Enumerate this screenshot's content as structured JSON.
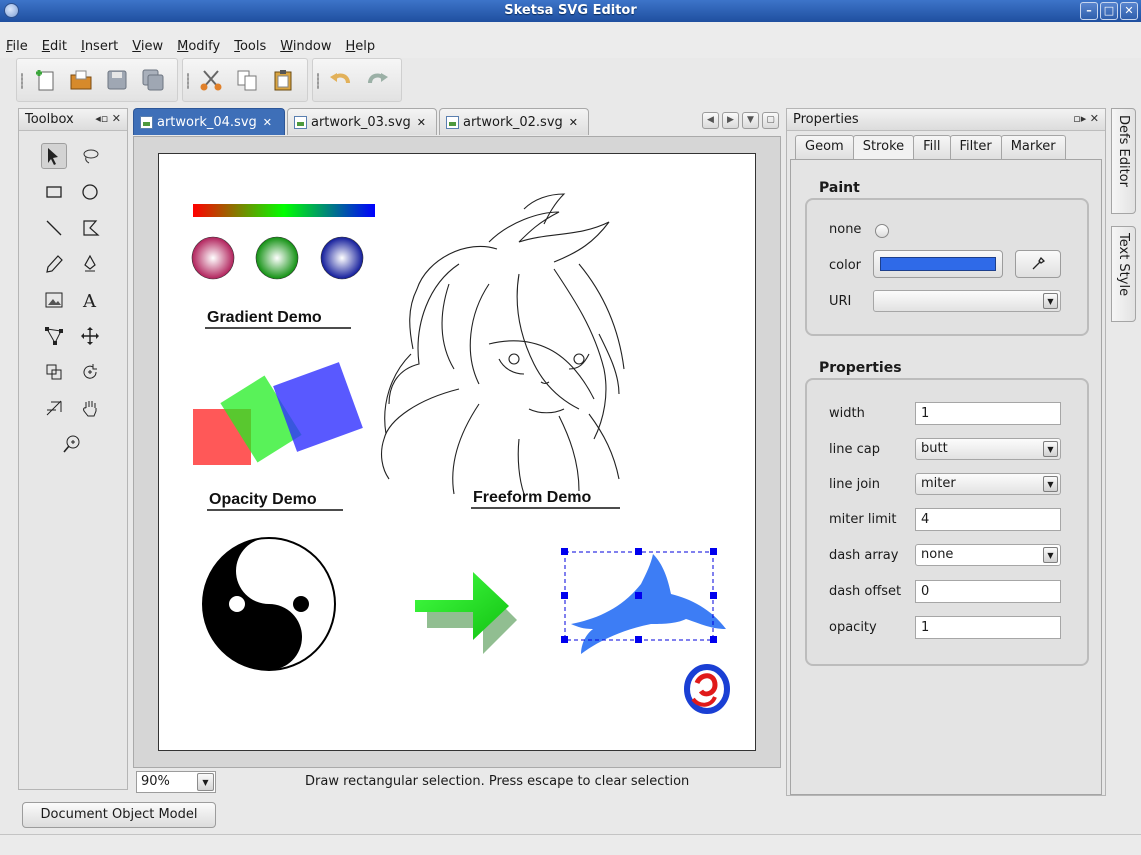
{
  "window": {
    "title": "Sketsa SVG Editor",
    "controls": [
      "minimize",
      "maximize",
      "close"
    ]
  },
  "menu": {
    "items": [
      {
        "label": "File",
        "mnemonic": "F"
      },
      {
        "label": "Edit",
        "mnemonic": "E"
      },
      {
        "label": "Insert",
        "mnemonic": "I"
      },
      {
        "label": "View",
        "mnemonic": "V"
      },
      {
        "label": "Modify",
        "mnemonic": "M"
      },
      {
        "label": "Tools",
        "mnemonic": "T"
      },
      {
        "label": "Window",
        "mnemonic": "W"
      },
      {
        "label": "Help",
        "mnemonic": "H"
      }
    ]
  },
  "toolbar": {
    "groups": [
      [
        "new-file-icon",
        "open-folder-icon",
        "save-icon",
        "save-all-icon"
      ],
      [
        "cut-icon",
        "copy-icon",
        "paste-icon"
      ],
      [
        "undo-icon",
        "redo-icon"
      ]
    ]
  },
  "toolbox": {
    "title": "Toolbox",
    "tools": [
      "select-arrow-icon",
      "lasso-icon",
      "rectangle-icon",
      "ellipse-icon",
      "line-icon",
      "polyline-icon",
      "pencil-icon",
      "pen-icon",
      "image-icon",
      "text-icon",
      "node-edit-icon",
      "move-icon",
      "transform-icon",
      "rotate-icon",
      "gradient-icon",
      "hand-icon",
      "zoom-icon"
    ]
  },
  "documents": {
    "tabs": [
      {
        "label": "artwork_04.svg",
        "active": true
      },
      {
        "label": "artwork_03.svg",
        "active": false
      },
      {
        "label": "artwork_02.svg",
        "active": false
      }
    ]
  },
  "canvas": {
    "labels": {
      "gradient": "Gradient Demo",
      "opacity": "Opacity Demo",
      "freeform": "Freeform Demo"
    },
    "colors": {
      "gradient_red": "#b0205a",
      "gradient_green": "#109010",
      "gradient_blue": "#101a9a",
      "opacity_red": "#ff4444",
      "opacity_green": "#33ee33",
      "opacity_blue": "#3333ff",
      "arrow": "#22dd22",
      "dolphin": "#3d7df5",
      "selection": "#0000dd"
    }
  },
  "statusbar": {
    "zoom": "90%",
    "message": "Draw rectangular selection. Press escape to clear selection"
  },
  "properties": {
    "title": "Properties",
    "tabs": [
      "Geom",
      "Stroke",
      "Fill",
      "Filter",
      "Marker"
    ],
    "active_tab": "Stroke",
    "paint": {
      "title": "Paint",
      "none_label": "none",
      "color_label": "color",
      "color_value": "#2f6ae8",
      "uri_label": "URI",
      "uri_value": ""
    },
    "props": {
      "title": "Properties",
      "width_label": "width",
      "width_value": "1",
      "linecap_label": "line cap",
      "linecap_value": "butt",
      "linejoin_label": "line join",
      "linejoin_value": "miter",
      "miterlimit_label": "miter limit",
      "miterlimit_value": "4",
      "dasharray_label": "dash array",
      "dasharray_value": "none",
      "dashoffset_label": "dash offset",
      "dashoffset_value": "0",
      "opacity_label": "opacity",
      "opacity_value": "1"
    }
  },
  "side_tabs": [
    "Defs Editor",
    "Text Style"
  ],
  "bottom": {
    "dom_button": "Document Object Model"
  }
}
